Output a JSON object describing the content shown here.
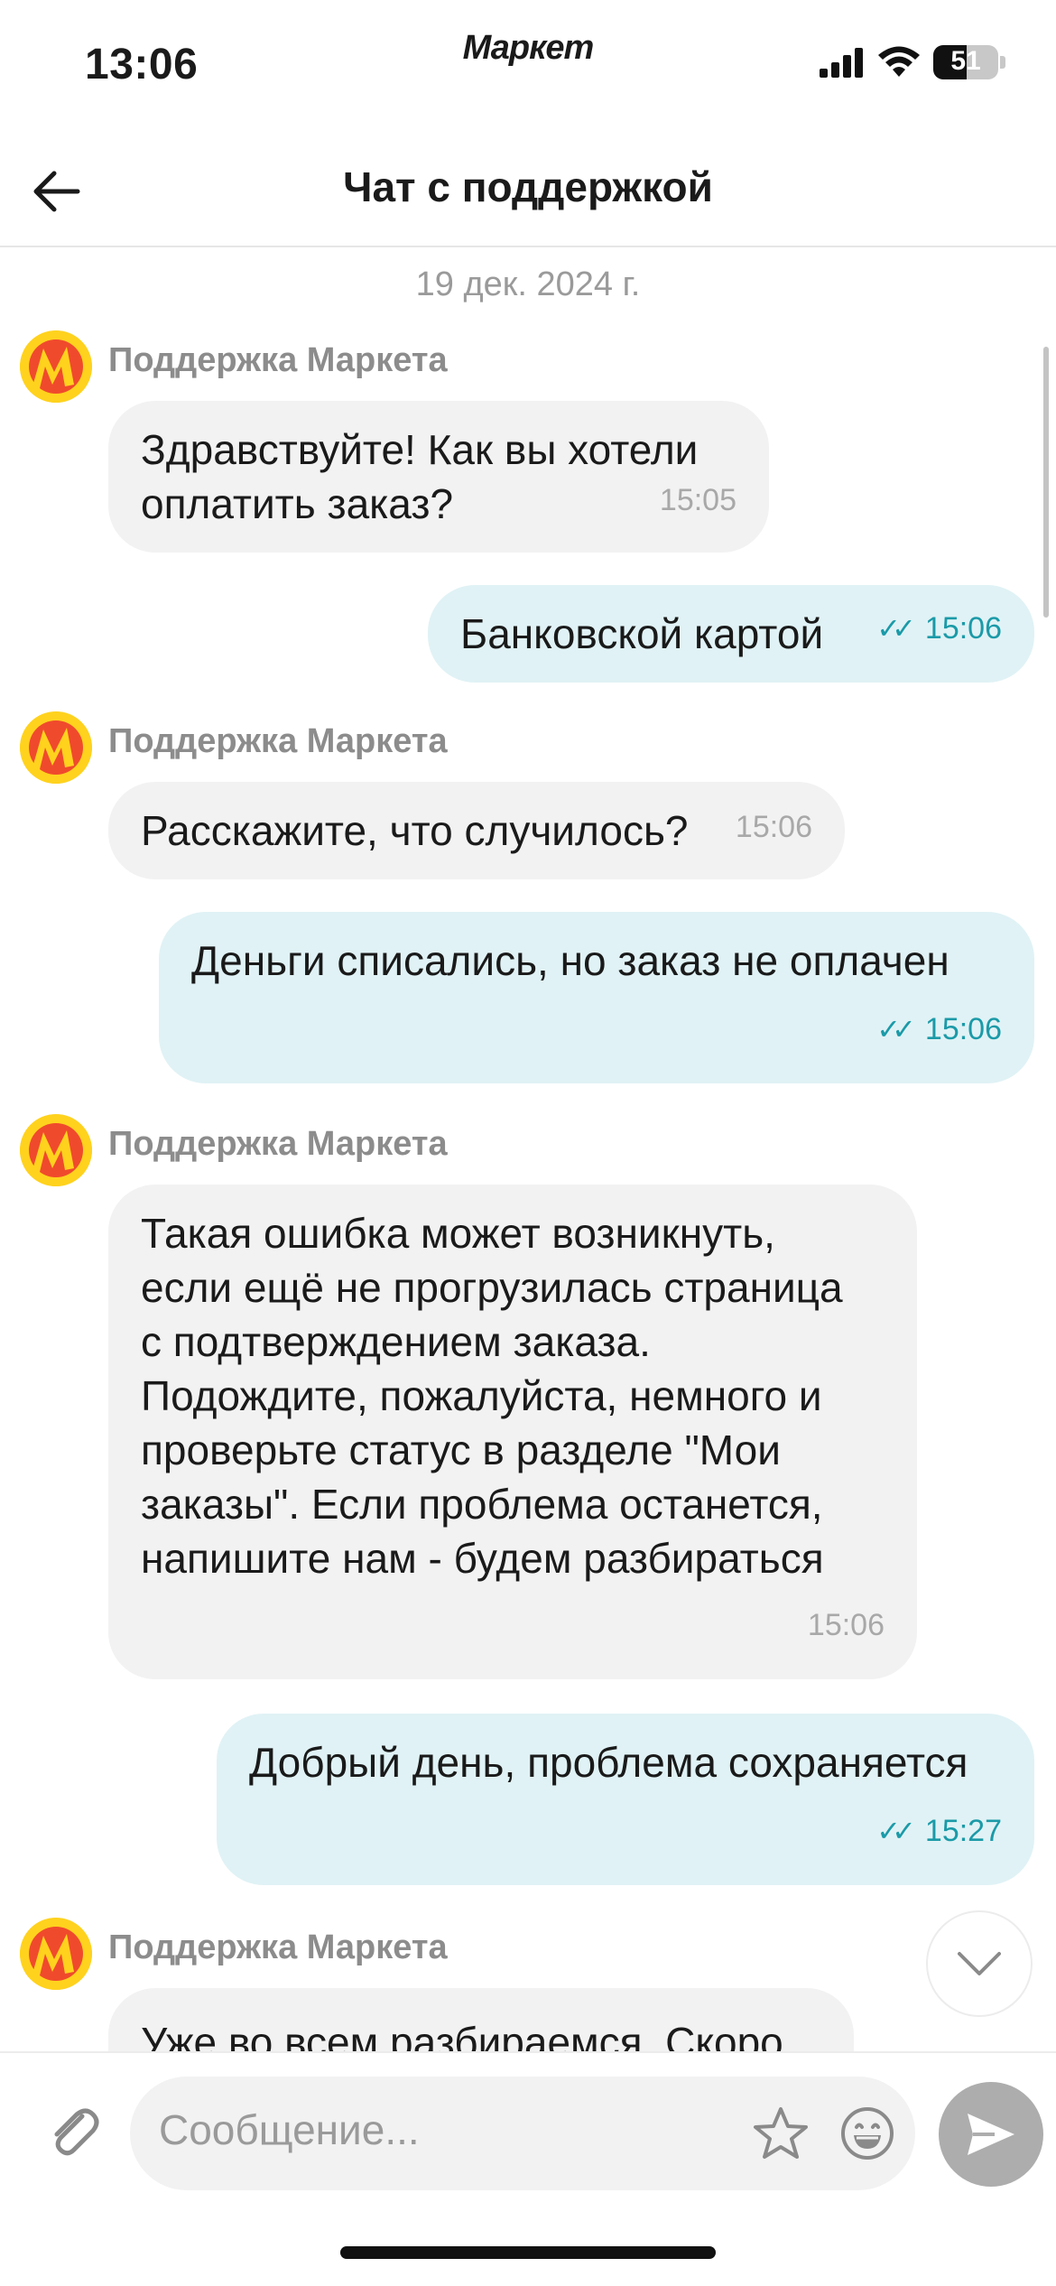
{
  "status_bar": {
    "time": "13:06",
    "brand": "Маркет",
    "battery": "51"
  },
  "header": {
    "title": "Чат с поддержкой"
  },
  "chat": {
    "date": "19 дек. 2024 г.",
    "sender_name": "Поддержка Маркета",
    "messages": [
      {
        "direction": "in",
        "lines": [
          "Здравствуйте! Как вы хотели",
          "оплатить заказ?"
        ],
        "time": "15:05"
      },
      {
        "direction": "out",
        "lines": [
          "Банковской картой"
        ],
        "time": "15:06"
      },
      {
        "direction": "in",
        "lines": [
          "Расскажите, что случилось?"
        ],
        "time": "15:06"
      },
      {
        "direction": "out",
        "lines": [
          "Деньги списались, но заказ не оплачен"
        ],
        "time": "15:06"
      },
      {
        "direction": "in",
        "lines": [
          "Такая ошибка может возникнуть,",
          "если ещё не прогрузилась страница",
          "с подтверждением заказа.",
          "Подождите, пожалуйста, немного и",
          "проверьте статус в разделе \"Мои",
          "заказы\". Если проблема останется,",
          "напишите нам - будем разбираться"
        ],
        "time": "15:06"
      },
      {
        "direction": "out",
        "lines": [
          "Добрый день, проблема сохраняется"
        ],
        "time": "15:27"
      },
      {
        "direction": "in",
        "lines": [
          "Уже во всем разбираемся. Скоро"
        ],
        "time": ""
      }
    ]
  },
  "composer": {
    "placeholder": "Сообщение..."
  },
  "colors": {
    "incoming_bubble": "#f2f2f2",
    "outgoing_bubble": "#e0f2f5",
    "accent": "#1b9aa8",
    "logo_red": "#f04a2c",
    "logo_yellow": "#ffd21e"
  },
  "icons": [
    "back-arrow-icon",
    "signal-icon",
    "wifi-icon",
    "battery-icon",
    "market-logo-icon",
    "double-check-icon",
    "chevron-down-icon",
    "paperclip-icon",
    "star-icon",
    "emoji-icon",
    "send-icon"
  ]
}
